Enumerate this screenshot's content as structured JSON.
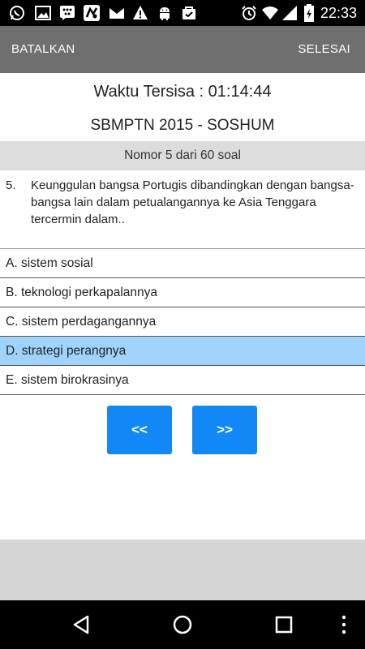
{
  "status_bar": {
    "time": "22:33",
    "left_icons": [
      "whatsapp-icon",
      "image-icon",
      "bbm-icon",
      "game-icon",
      "mail-icon",
      "warning-icon",
      "android-icon",
      "bag-icon"
    ],
    "right_icons": [
      "alarm-icon",
      "wifi-icon",
      "signal-icon",
      "battery-icon"
    ]
  },
  "action_bar": {
    "cancel_label": "BATALKAN",
    "done_label": "SELESAI",
    "background": "#6f6f6f"
  },
  "timer": {
    "text": "Waktu Tersisa : 01:14:44"
  },
  "exam": {
    "title": "SBMPTN 2015 - SOSHUM"
  },
  "question_bar": {
    "text": "Nomor 5 dari 60 soal"
  },
  "question": {
    "number": "5.",
    "text": "Keunggulan bangsa Portugis dibandingkan dengan bangsa-bangsa lain dalam petualangannya ke Asia Tenggara tercermin dalam.."
  },
  "options": [
    {
      "label": "A. sistem sosial",
      "selected": false
    },
    {
      "label": "B. teknologi perkapalannya",
      "selected": false
    },
    {
      "label": "C. sistem perdagangannya",
      "selected": false
    },
    {
      "label": "D. strategi perangnya",
      "selected": true
    },
    {
      "label": "E. sistem birokrasinya",
      "selected": false
    }
  ],
  "navigation": {
    "prev_label": "<<",
    "next_label": ">>",
    "button_color": "#1188f5"
  },
  "colors": {
    "selected_option": "#9fd3fb",
    "question_bar": "#dcdcdc",
    "footer": "#d6d6d6"
  },
  "system_nav": {
    "icons": [
      "back-icon",
      "home-icon",
      "recents-icon",
      "menu-icon"
    ]
  }
}
